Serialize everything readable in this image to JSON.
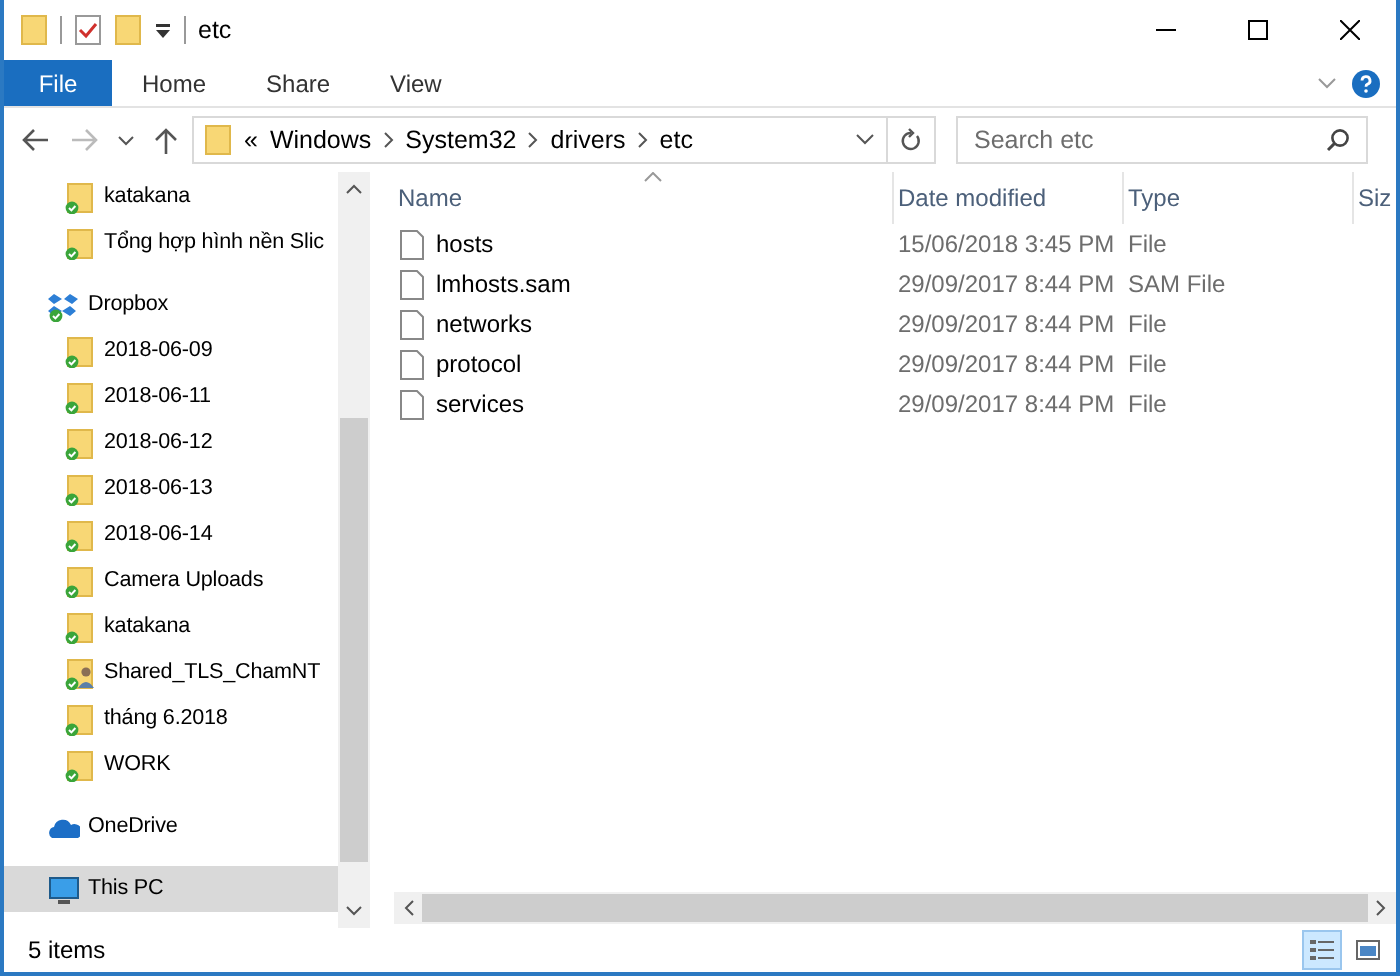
{
  "window": {
    "title": "etc"
  },
  "ribbon_tabs": [
    {
      "label": "File",
      "selected": true
    },
    {
      "label": "Home",
      "selected": false
    },
    {
      "label": "Share",
      "selected": false
    },
    {
      "label": "View",
      "selected": false
    }
  ],
  "address": {
    "overflow": "«",
    "crumbs": [
      "Windows",
      "System32",
      "drivers",
      "etc"
    ]
  },
  "search": {
    "placeholder": "Search etc"
  },
  "nav": {
    "continued_children": [
      {
        "label": "katakana",
        "kind": "folder",
        "selected": false
      },
      {
        "label": "Tổng hợp hình nền Slic",
        "kind": "folder",
        "selected": false
      }
    ],
    "items": [
      {
        "label": "Dropbox",
        "kind": "dropbox",
        "selected": false,
        "children": [
          {
            "label": "2018-06-09",
            "kind": "folder",
            "selected": false
          },
          {
            "label": "2018-06-11",
            "kind": "folder",
            "selected": false
          },
          {
            "label": "2018-06-12",
            "kind": "folder",
            "selected": false
          },
          {
            "label": "2018-06-13",
            "kind": "folder",
            "selected": false
          },
          {
            "label": "2018-06-14",
            "kind": "folder",
            "selected": false
          },
          {
            "label": "Camera Uploads",
            "kind": "folder",
            "selected": false
          },
          {
            "label": "katakana",
            "kind": "folder",
            "selected": false
          },
          {
            "label": "Shared_TLS_ChamNT",
            "kind": "shared-folder",
            "selected": false
          },
          {
            "label": "tháng 6.2018",
            "kind": "folder",
            "selected": false
          },
          {
            "label": "WORK",
            "kind": "folder",
            "selected": false
          }
        ]
      },
      {
        "label": "OneDrive",
        "kind": "onedrive",
        "selected": false
      },
      {
        "label": "This PC",
        "kind": "pc",
        "selected": true
      }
    ]
  },
  "table": {
    "columns": [
      "Name",
      "Date modified",
      "Type",
      "Siz"
    ],
    "rows": [
      [
        "hosts",
        "15/06/2018 3:45 PM",
        "File"
      ],
      [
        "lmhosts.sam",
        "29/09/2017 8:44 PM",
        "SAM File"
      ],
      [
        "networks",
        "29/09/2017 8:44 PM",
        "File"
      ],
      [
        "protocol",
        "29/09/2017 8:44 PM",
        "File"
      ],
      [
        "services",
        "29/09/2017 8:44 PM",
        "File"
      ]
    ]
  },
  "status_bar": {
    "count": "5 items",
    "views": [
      {
        "kind": "details",
        "selected": true
      },
      {
        "kind": "large-icons",
        "selected": false
      }
    ]
  }
}
